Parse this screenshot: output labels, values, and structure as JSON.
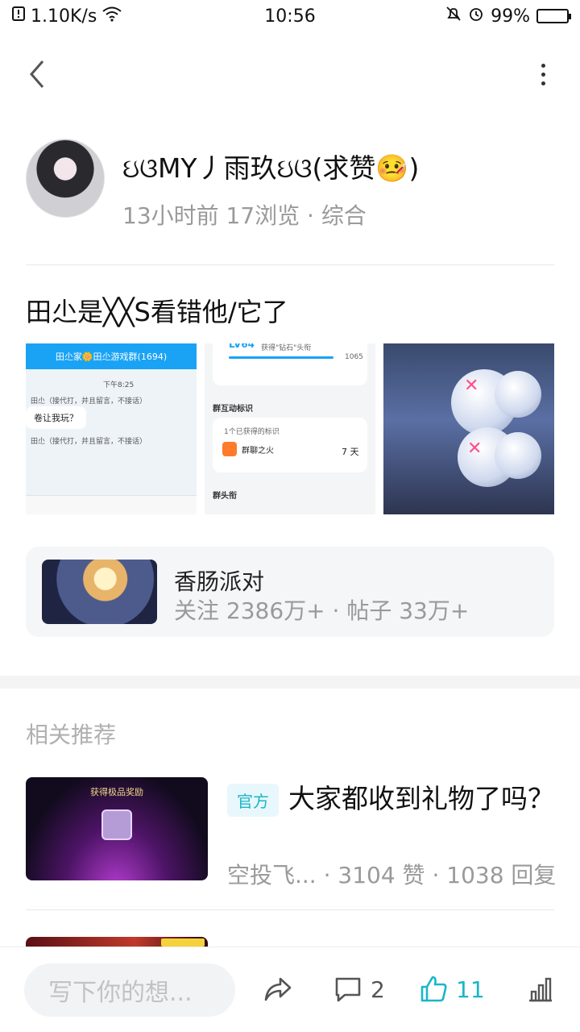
{
  "status_bar": {
    "speed": "1.10K/s",
    "time": "10:56",
    "battery": "99%",
    "battery_level": 0.99
  },
  "post": {
    "author_name": "ઇଓMY丿雨玖ઇଓ(求赞🤒)",
    "meta": "13小时前 17浏览 · 综合",
    "title": "田尐是╳╳S看错他/它了"
  },
  "images": {
    "img1": {
      "header": "田尐家🌼田尐游戏群(1694)",
      "time": "下午8:25",
      "line1": "田尐（接代打，并且留言，不接话）",
      "bubble": "卷让我玩？",
      "line2": "田尐（接代打，并且留言，不接话）"
    },
    "img2": {
      "level": "LV64",
      "level_note": "获得\"钻石\"头衔",
      "score": "1065",
      "section1": "群互动标识",
      "count_note": "1个已获得的标识",
      "badge_name": "群聊之火",
      "badge_days": "7 天",
      "section2": "群头衔"
    }
  },
  "forum": {
    "name": "香肠派对",
    "stats": "关注 2386万+ · 帖子 33万+"
  },
  "related": {
    "section_title": "相关推荐",
    "items": [
      {
        "thumb_text": "获得极品奖励",
        "tag": "官方",
        "title": "大家都收到礼物了吗？",
        "meta": "空投飞... · 3104 赞 · 1038 回复"
      }
    ]
  },
  "bottom_bar": {
    "input_placeholder": "写下你的想...",
    "comment_count": "2",
    "like_count": "11"
  },
  "colors": {
    "accent": "#1ab6c9",
    "link_blue": "#1aa3f5",
    "muted_text": "#9a9a9a"
  }
}
